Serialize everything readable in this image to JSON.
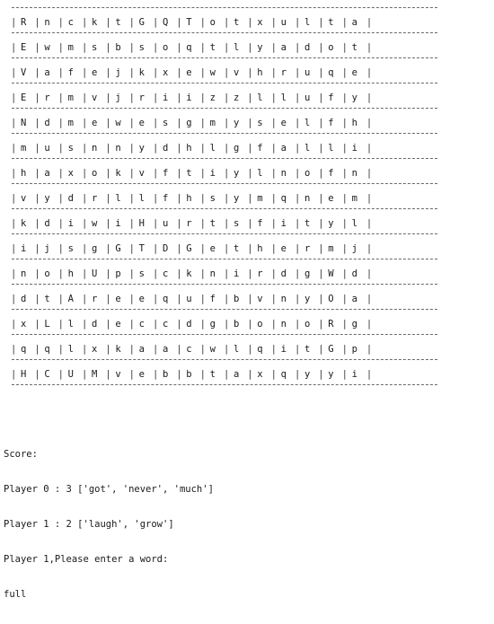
{
  "board": {
    "rows": [
      [
        "R",
        "n",
        "c",
        "k",
        "t",
        "G",
        "Q",
        "T",
        "o",
        "t",
        "x",
        "u",
        "l",
        "t",
        "a"
      ],
      [
        "E",
        "w",
        "m",
        "s",
        "b",
        "s",
        "o",
        "q",
        "t",
        "l",
        "y",
        "a",
        "d",
        "o",
        "t"
      ],
      [
        "V",
        "a",
        "f",
        "e",
        "j",
        "k",
        "x",
        "e",
        "w",
        "v",
        "h",
        "r",
        "u",
        "q",
        "e"
      ],
      [
        "E",
        "r",
        "m",
        "v",
        "j",
        "r",
        "i",
        "i",
        "z",
        "z",
        "l",
        "l",
        "u",
        "f",
        "y"
      ],
      [
        "N",
        "d",
        "m",
        "e",
        "w",
        "e",
        "s",
        "g",
        "m",
        "y",
        "s",
        "e",
        "l",
        "f",
        "h"
      ],
      [
        "m",
        "u",
        "s",
        "n",
        "n",
        "y",
        "d",
        "h",
        "l",
        "g",
        "f",
        "a",
        "l",
        "l",
        "i"
      ],
      [
        "h",
        "a",
        "x",
        "o",
        "k",
        "v",
        "f",
        "t",
        "i",
        "y",
        "l",
        "n",
        "o",
        "f",
        "n"
      ],
      [
        "v",
        "y",
        "d",
        "r",
        "l",
        "l",
        "f",
        "h",
        "s",
        "y",
        "m",
        "q",
        "n",
        "e",
        "m"
      ],
      [
        "k",
        "d",
        "i",
        "w",
        "i",
        "H",
        "u",
        "r",
        "t",
        "s",
        "f",
        "i",
        "t",
        "y",
        "l"
      ],
      [
        "i",
        "j",
        "s",
        "g",
        "G",
        "T",
        "D",
        "G",
        "e",
        "t",
        "h",
        "e",
        "r",
        "m",
        "j"
      ],
      [
        "n",
        "o",
        "h",
        "U",
        "p",
        "s",
        "c",
        "k",
        "n",
        "i",
        "r",
        "d",
        "g",
        "W",
        "d"
      ],
      [
        "d",
        "t",
        "A",
        "r",
        "e",
        "e",
        "q",
        "u",
        "f",
        "b",
        "v",
        "n",
        "y",
        "O",
        "a"
      ],
      [
        "x",
        "L",
        "l",
        "d",
        "e",
        "c",
        "c",
        "d",
        "g",
        "b",
        "o",
        "n",
        "o",
        "R",
        "g"
      ],
      [
        "q",
        "q",
        "l",
        "x",
        "k",
        "a",
        "a",
        "c",
        "w",
        "l",
        "q",
        "i",
        "t",
        "G",
        "p"
      ],
      [
        "H",
        "C",
        "U",
        "M",
        "v",
        "e",
        "b",
        "b",
        "t",
        "a",
        "x",
        "q",
        "y",
        "y",
        "i"
      ]
    ]
  },
  "console": {
    "score_header": "Score:",
    "player0_line": "Player 0 : 3 ['got', 'never', 'much']",
    "player1_line": "Player 1 : 2 ['laugh', 'grow']",
    "prompt_line": "Player 1,Please enter a word:",
    "input_value": "full"
  }
}
